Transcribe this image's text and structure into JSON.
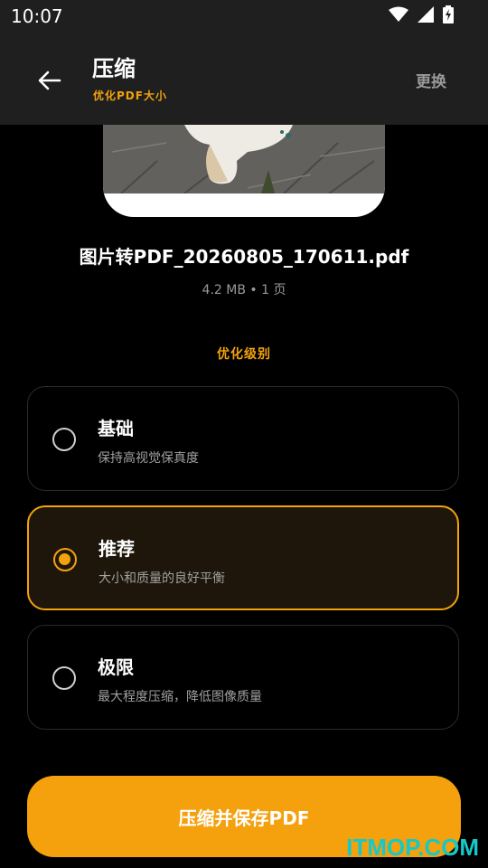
{
  "status_bar": {
    "time": "10:07",
    "icons": [
      "wifi-icon",
      "cell-signal-icon",
      "battery-charging-icon"
    ]
  },
  "header": {
    "title": "压缩",
    "subtitle": "优化PDF大小",
    "action_label": "更换"
  },
  "file": {
    "name": "图片转PDF_20260805_170611.pdf",
    "info": "4.2 MB • 1 页"
  },
  "section": {
    "label": "优化级别"
  },
  "options": [
    {
      "title": "基础",
      "description": "保持高视觉保真度",
      "selected": false
    },
    {
      "title": "推荐",
      "description": "大小和质量的良好平衡",
      "selected": true
    },
    {
      "title": "极限",
      "description": "最大程度压缩，降低图像质量",
      "selected": false
    }
  ],
  "cta": {
    "label": "压缩并保存PDF"
  },
  "watermark": "ITMOP.COM",
  "colors": {
    "accent": "#f4a10d",
    "background": "#000000",
    "appbar": "#1f1f1f",
    "watermark": "#17c8c9"
  }
}
